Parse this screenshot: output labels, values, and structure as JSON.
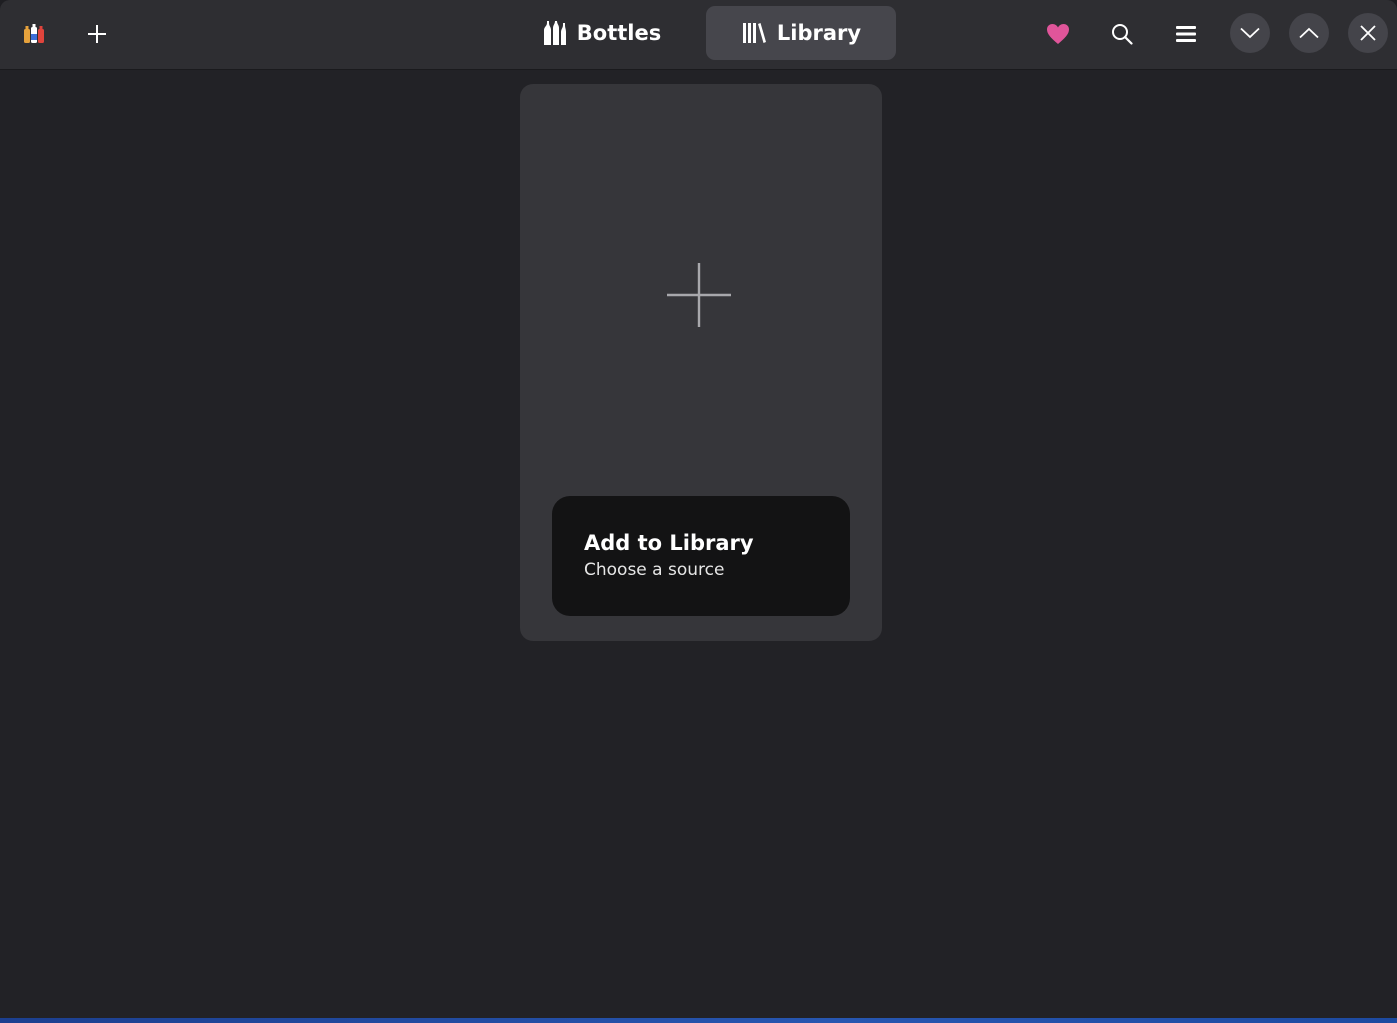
{
  "window": {
    "colors": {
      "background": "#222226",
      "headerbar": "#2e2e32",
      "card": "#36363a",
      "card_label": "#131314",
      "accent_heart": "#e0559a"
    }
  },
  "headerbar": {
    "app_icon": "bottles-app-icon",
    "add_icon": "plus-icon",
    "tabs": [
      {
        "label": "Bottles",
        "icon": "bottles-icon",
        "active": false
      },
      {
        "label": "Library",
        "icon": "library-icon",
        "active": true
      }
    ],
    "actions": [
      {
        "icon": "heart-icon"
      },
      {
        "icon": "search-icon"
      },
      {
        "icon": "hamburger-menu-icon"
      }
    ],
    "window_controls": [
      {
        "icon": "chevron-down-icon"
      },
      {
        "icon": "chevron-up-icon"
      },
      {
        "icon": "close-icon"
      }
    ]
  },
  "library": {
    "add_card": {
      "icon": "plus-icon",
      "title": "Add to Library",
      "subtitle": "Choose a source"
    }
  }
}
